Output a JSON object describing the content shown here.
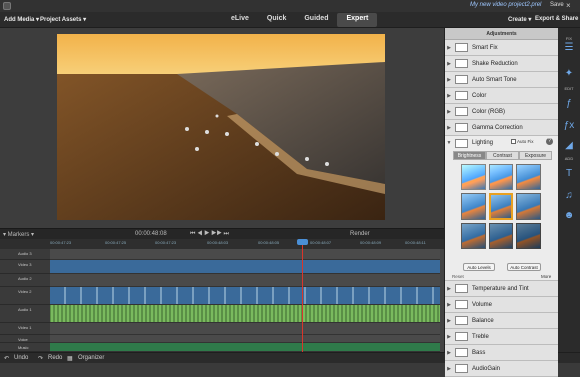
{
  "window": {
    "title": "My new video project2.prel",
    "save": "Save",
    "close": "×"
  },
  "menu": {
    "add_media": "Add Media ▾",
    "project_assets": "Project Assets ▾",
    "create": "Create ▾",
    "export_share": "Export & Share"
  },
  "modes": [
    "eLive",
    "Quick",
    "Guided",
    "Expert"
  ],
  "transport": {
    "markers": "▾ Markers ▾",
    "timecode": "00:00:48:08",
    "render": "Render"
  },
  "ruler": [
    "00:00:47:23",
    "00:00:47:25",
    "00:00:47:23",
    "00:00:48:03",
    "00:00:48:05",
    "00:00:48:07",
    "00:00:48:09",
    "00:00:48:11",
    "00:00:48:13"
  ],
  "tracks": [
    "Audio 3",
    "Video 3",
    "Audio 2",
    "Video 2",
    "Audio 1",
    "Video 1",
    "Voice",
    "Music"
  ],
  "bottom": {
    "undo": "Undo",
    "redo": "Redo",
    "organizer": "Organizer"
  },
  "panel": {
    "title": "Adjustments",
    "items_top": [
      "Smart Fix",
      "Shake Reduction",
      "Auto Smart Tone",
      "Color",
      "Color (RGB)",
      "Gamma Correction"
    ],
    "lighting": {
      "label": "Lighting",
      "auto_fix": "Auto Fix",
      "help": "?",
      "tabs": [
        "Brightness",
        "Contrast",
        "Exposure"
      ],
      "auto_levels": "Auto Levels",
      "auto_contrast": "Auto Contrast",
      "reset": "Reset",
      "more": "More"
    },
    "items_bottom": [
      "Temperature and Tint",
      "Volume",
      "Balance",
      "Treble",
      "Bass",
      "AudioGain"
    ]
  },
  "rside": {
    "fix": "FIX",
    "edit": "EDIT",
    "add": "ADD"
  }
}
